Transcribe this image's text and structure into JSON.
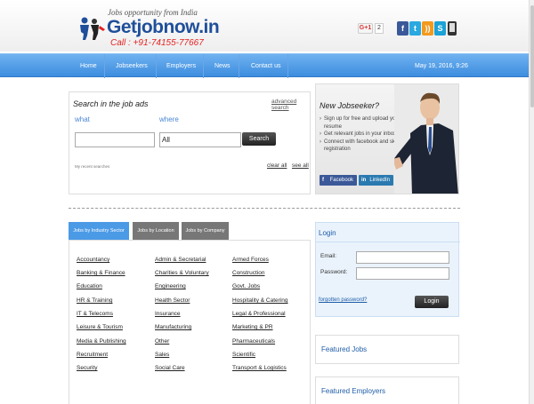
{
  "header": {
    "tagline": "Jobs opportunity from India",
    "logo_text": "Getjobnow.in",
    "phone": "Call : +91-74155-77667",
    "gplus_label": "G+1",
    "gplus_count": "2",
    "social_icons": [
      "facebook-icon",
      "twitter-icon",
      "rss-icon",
      "skype-icon",
      "mobile-icon"
    ]
  },
  "nav": {
    "items": [
      "Home",
      "Jobseekers",
      "Employers",
      "News",
      "Contact us"
    ],
    "datetime": "May 19, 2016, 9:26"
  },
  "search": {
    "title": "Search in the job ads",
    "advanced_label": "advanced search",
    "what_label": "what",
    "where_label": "where",
    "what_value": "",
    "where_value": "All",
    "button_label": "Search",
    "recent_label": "My recent searches",
    "clear_all": "clear all",
    "see_all": "see all"
  },
  "new_jobseeker": {
    "title": "New Jobseeker?",
    "points": [
      "Sign up for free and upload your resume",
      "Get relevant jobs in your inbox",
      "Connect with facebook and skip the registration"
    ],
    "facebook_label": "Facebook",
    "linkedin_label": "LinkedIn"
  },
  "tabs": [
    "Jobs by Industry Sector",
    "Jobs by Location",
    "Jobs by Company"
  ],
  "categories": [
    [
      "Accountancy",
      "Admin & Secretarial",
      "Armed Forces"
    ],
    [
      "Banking & Finance",
      "Charities & Voluntary",
      "Construction"
    ],
    [
      "Education",
      "Engineering",
      "Govt. Jobs"
    ],
    [
      "HR & Training",
      "Health Sector",
      "Hospitality & Catering"
    ],
    [
      "IT & Telecoms",
      "Insurance",
      "Legal & Professional"
    ],
    [
      "Leisure & Tourism",
      "Manufacturing",
      "Marketing & PR"
    ],
    [
      "Media & Publishing",
      "Other",
      "Pharmaceuticals"
    ],
    [
      "Recruitment",
      "Sales",
      "Scientific"
    ],
    [
      "Security",
      "Social Care",
      "Transport & Logistics"
    ]
  ],
  "login": {
    "title": "Login",
    "email_label": "Email:",
    "password_label": "Password:",
    "forgot_label": "forgotten password?",
    "button_label": "Login"
  },
  "featured_jobs": "Featured Jobs",
  "featured_employers": "Featured Employers",
  "colors": {
    "nav_blue": "#3d8ddf",
    "logo_blue": "#1f4f9a",
    "phone_red": "#e52222",
    "tab_active": "#4b9ae6",
    "tab_inactive": "#777777",
    "login_bg": "#eaf3fc"
  }
}
